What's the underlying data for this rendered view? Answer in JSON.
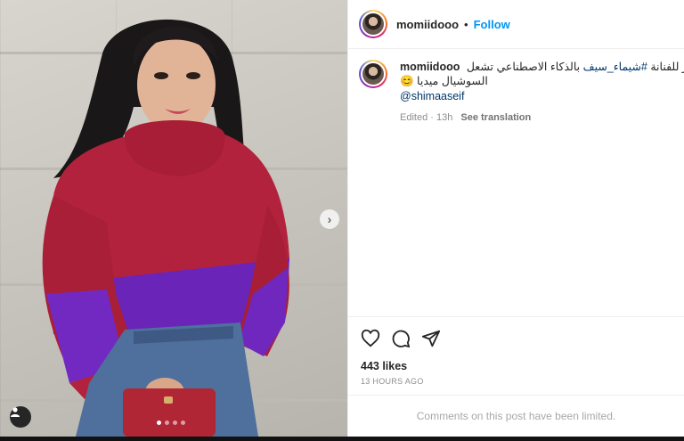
{
  "header": {
    "username": "momiidooo",
    "separator": "•",
    "follow_label": "Follow"
  },
  "caption": {
    "username": "momiidooo",
    "text_before": "صور للفنانة ",
    "hashtag": "#شيماء_سيف",
    "text_after": " بالذكاء الاصطناعي تشعل",
    "line2": "السوشيال ميديا 😊",
    "mention": "@shimaaseif",
    "edited": "Edited · 13h",
    "see_translation": "See translation"
  },
  "stats": {
    "likes": "443 likes",
    "time": "13 HOURS AGO"
  },
  "comments_notice": "Comments on this post have been limited.",
  "carousel": {
    "current": 1,
    "total": 4,
    "next_symbol": "›"
  },
  "icons": {
    "like": "heart-icon",
    "comment": "comment-icon",
    "share": "share-icon",
    "tags": "user-tag-icon",
    "next": "chevron-right-icon"
  },
  "colors": {
    "accent": "#0095f6",
    "sweater_red": "#b3223c",
    "sweater_purple": "#6a24b8"
  }
}
